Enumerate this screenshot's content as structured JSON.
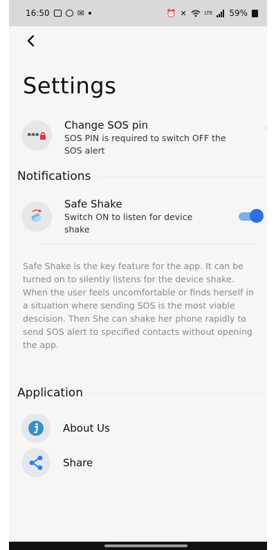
{
  "status_bar": {
    "time": "16:50",
    "battery": "59%",
    "network": "LTE"
  },
  "header": {
    "title": "Settings"
  },
  "change_pin": {
    "pin_mask": "***",
    "title": "Change SOS pin",
    "subtitle": "SOS PIN is required to switch OFF the SOS alert"
  },
  "notifications": {
    "heading": "Notifications",
    "safe_shake": {
      "title": "Safe Shake",
      "subtitle": "Switch ON to listen for device shake",
      "enabled": true
    },
    "description": "Safe Shake is the key feature for the app. It can be turned on to silently listens for the device shake. When the user feels uncomfortable or finds herself in a situation where sending SOS is the most viable descision. Then She can shake her phone rapidly to send SOS alert to specified contacts without opening the app."
  },
  "application": {
    "heading": "Application",
    "about_label": "About Us",
    "share_label": "Share"
  },
  "colors": {
    "toggle_on": "#2f6fe0",
    "info_icon": "#3a8fc9",
    "share_icon": "#2f7fe0"
  }
}
